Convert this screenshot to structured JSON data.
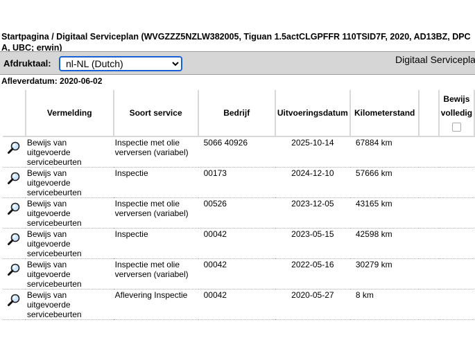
{
  "breadcrumb": "Startpagina / Digitaal Serviceplan (WVGZZZ5NZLW382005, Tiguan 1.5actCLGPFFR 110TSID7F, 2020, AD13BZ, DPCA, UBC; erwin)",
  "printlang": {
    "label": "Afdruktaal:",
    "selected": "nl-NL (Dutch)"
  },
  "page_title": "Digitaal Serviceplan",
  "delivery": "Afleverdatum: 2020-06-02",
  "table": {
    "headers": [
      "Vermelding",
      "Soort service",
      "Bedrijf",
      "Uitvoeringsdatum",
      "Kilometerstand",
      "",
      "Bewijs volledig"
    ],
    "rows": [
      {
        "vermelding": "Bewijs van uitgevoerde servicebeurten",
        "soort": "Inspectie met olie verversen (variabel)",
        "bedrijf": "5066 40926",
        "datum": "2025-10-14",
        "km": "67884 km"
      },
      {
        "vermelding": "Bewijs van uitgevoerde servicebeurten",
        "soort": "Inspectie",
        "bedrijf": "00173",
        "datum": "2024-12-10",
        "km": "57666 km"
      },
      {
        "vermelding": "Bewijs van uitgevoerde servicebeurten",
        "soort": "Inspectie met olie verversen (variabel)",
        "bedrijf": "00526",
        "datum": "2023-12-05",
        "km": "43165 km"
      },
      {
        "vermelding": "Bewijs van uitgevoerde servicebeurten",
        "soort": "Inspectie",
        "bedrijf": "00042",
        "datum": "2023-05-15",
        "km": "42598 km"
      },
      {
        "vermelding": "Bewijs van uitgevoerde servicebeurten",
        "soort": "Inspectie met olie verversen (variabel)",
        "bedrijf": "00042",
        "datum": "2022-05-16",
        "km": "30279 km"
      },
      {
        "vermelding": "Bewijs van uitgevoerde servicebeurten",
        "soort": "Aflevering Inspectie",
        "bedrijf": "00042",
        "datum": "2020-05-27",
        "km": "8 km"
      }
    ]
  }
}
